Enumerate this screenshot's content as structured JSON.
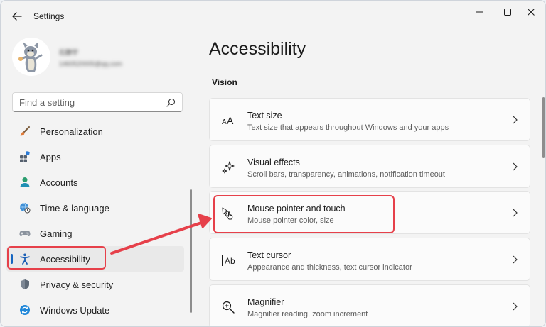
{
  "window": {
    "title": "Settings"
  },
  "user": {
    "name": "石静宇",
    "email": "1460520005@qq.com"
  },
  "search": {
    "placeholder": "Find a setting"
  },
  "nav": {
    "items": [
      {
        "label": "Personalization",
        "icon": "paintbrush-icon"
      },
      {
        "label": "Apps",
        "icon": "apps-icon"
      },
      {
        "label": "Accounts",
        "icon": "person-icon"
      },
      {
        "label": "Time & language",
        "icon": "globe-clock-icon"
      },
      {
        "label": "Gaming",
        "icon": "gamepad-icon"
      },
      {
        "label": "Accessibility",
        "icon": "accessibility-icon",
        "active": true
      },
      {
        "label": "Privacy & security",
        "icon": "shield-icon"
      },
      {
        "label": "Windows Update",
        "icon": "sync-icon"
      }
    ]
  },
  "main": {
    "title": "Accessibility",
    "section": "Vision",
    "cards": [
      {
        "title": "Text size",
        "desc": "Text size that appears throughout Windows and your apps",
        "icon": "text-size-icon"
      },
      {
        "title": "Visual effects",
        "desc": "Scroll bars, transparency, animations, notification timeout",
        "icon": "sparkle-icon"
      },
      {
        "title": "Mouse pointer and touch",
        "desc": "Mouse pointer color, size",
        "icon": "pointer-hand-icon"
      },
      {
        "title": "Text cursor",
        "desc": "Appearance and thickness, text cursor indicator",
        "icon": "text-cursor-icon"
      },
      {
        "title": "Magnifier",
        "desc": "Magnifier reading, zoom increment",
        "icon": "magnifier-icon"
      }
    ]
  },
  "colors": {
    "accent": "#1565c0",
    "highlight": "#e6404a"
  }
}
